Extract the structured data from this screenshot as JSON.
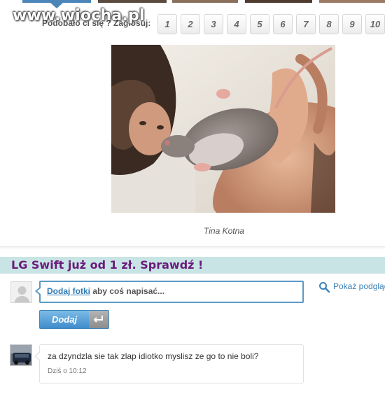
{
  "watermark": "www.wiocha.pl",
  "vote": {
    "label": "Podobało ci się ? Zagłosuj:",
    "options": [
      "1",
      "2",
      "3",
      "4",
      "5",
      "6",
      "7",
      "8",
      "9",
      "10"
    ]
  },
  "post": {
    "caption": "Tina Kotna"
  },
  "promo": {
    "text": "LG Swift już od 1 zł. Sprawdź !"
  },
  "comment_form": {
    "link_text": "Dodaj fotki",
    "rest_text": " aby coś napisać...",
    "preview_label": "Pokaż podgląd",
    "submit_label": "Dodaj",
    "icons": {
      "preview": "magnifier-icon",
      "enter": "enter-arrow-icon",
      "avatar": "default-avatar-icon"
    }
  },
  "comments": [
    {
      "text": "za dzyndzla sie tak zlap idiotko myslisz ze go to nie boli?",
      "time": "Dziś o 10:12"
    }
  ],
  "colors": {
    "accent": "#4a86b8",
    "promo_bg": "#c9e4e5",
    "promo_text": "#6a1b7c",
    "link": "#2f7ab3"
  }
}
